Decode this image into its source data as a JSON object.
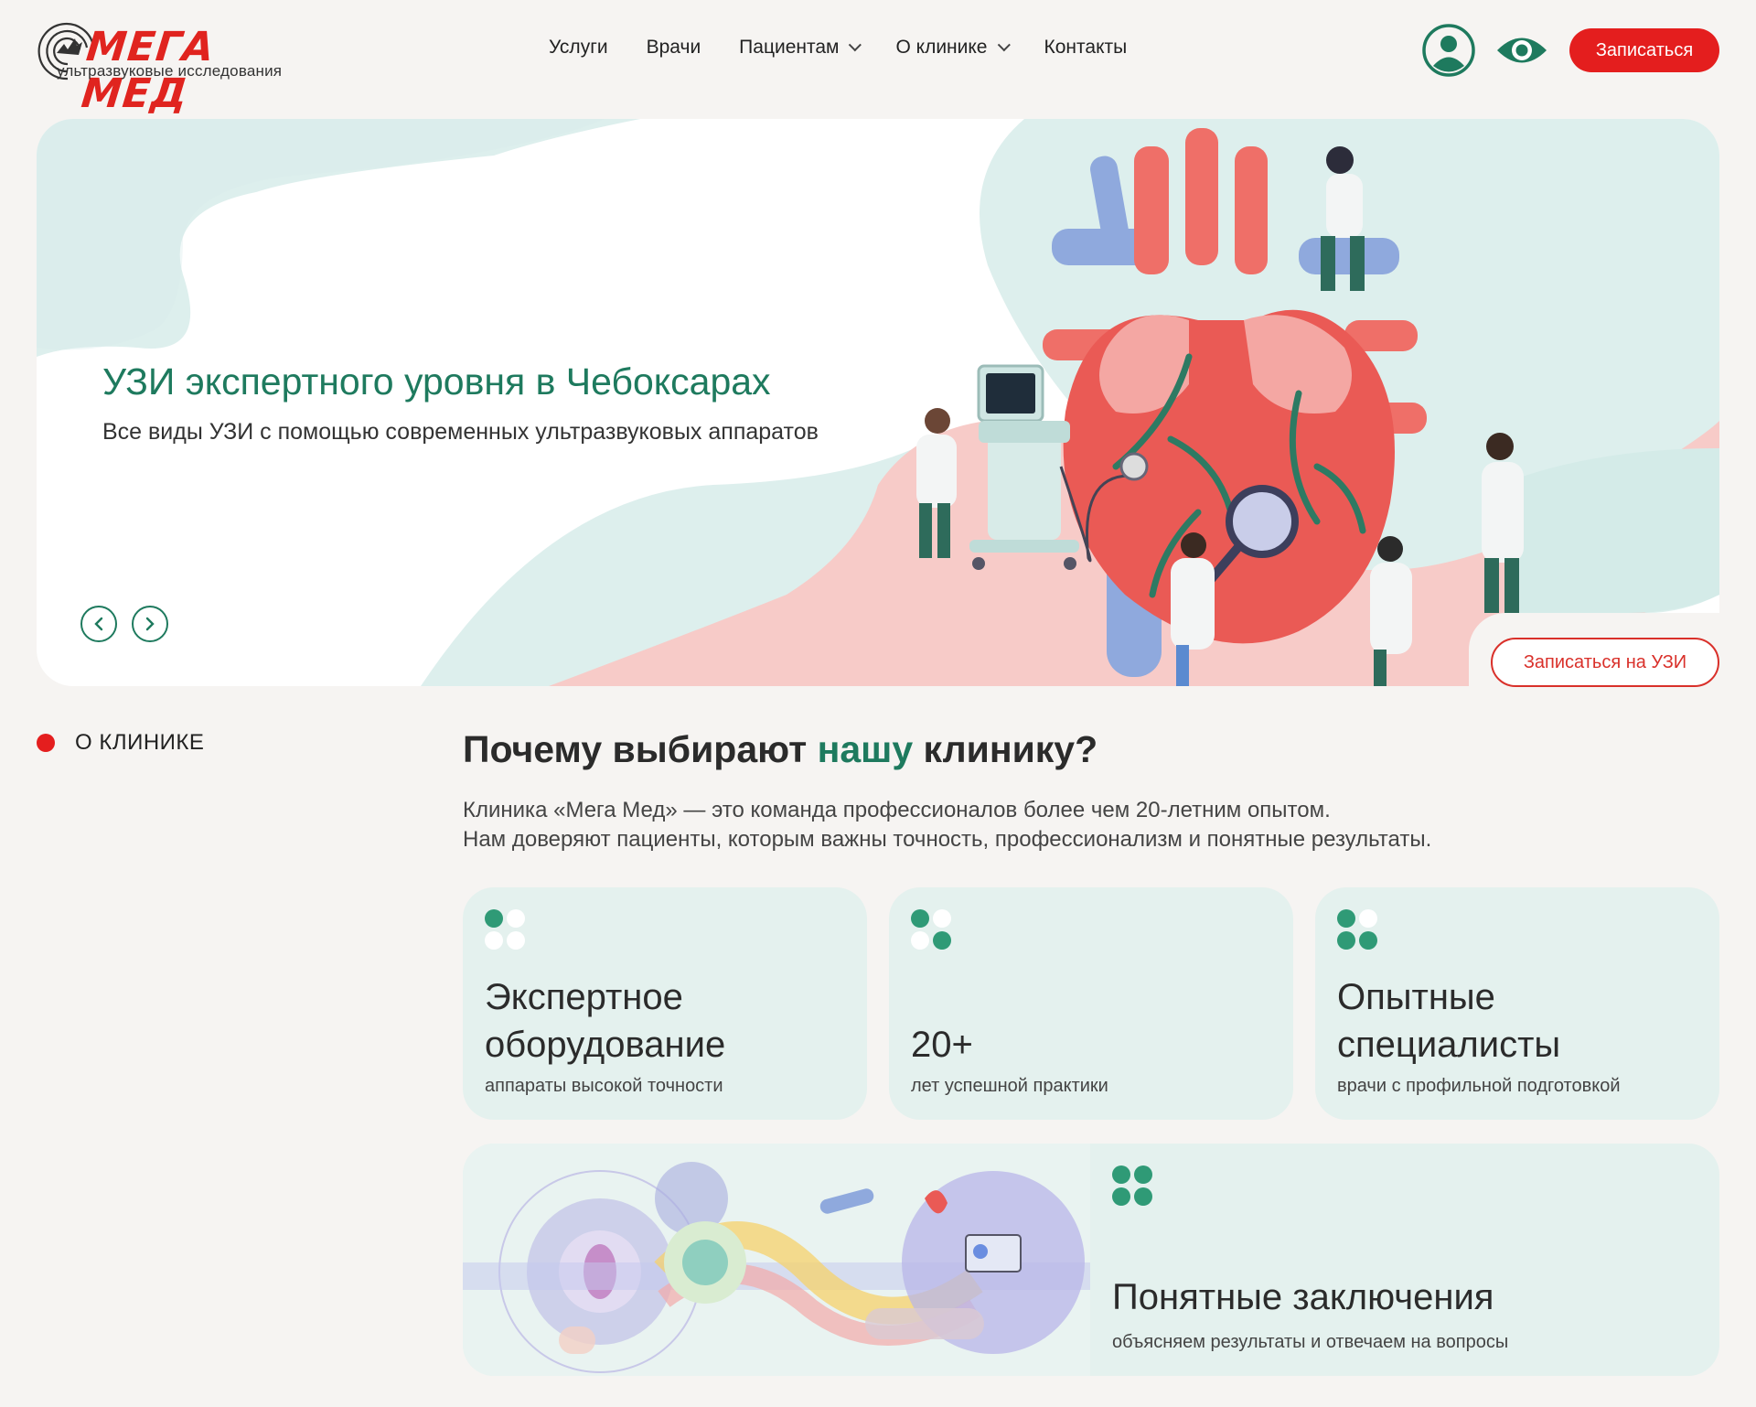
{
  "brand": {
    "name": "МЕГА МЕД",
    "tagline": "ультразвуковые исследования",
    "colors": {
      "red": "#e41e1e",
      "green": "#1e7a5e",
      "mint": "#e4f1ee"
    }
  },
  "nav": {
    "items": [
      {
        "label": "Услуги",
        "dropdown": false
      },
      {
        "label": "Врачи",
        "dropdown": false
      },
      {
        "label": "Пациентам",
        "dropdown": true
      },
      {
        "label": "О клинике",
        "dropdown": true
      },
      {
        "label": "Контакты",
        "dropdown": false
      }
    ],
    "user_icon": "user-account-icon",
    "accessibility_icon": "eye-icon",
    "cta_label": "Записаться"
  },
  "hero": {
    "title": "УЗИ экспертного уровня в Чебоксарах",
    "subtitle": "Все виды УЗИ с помощью современных ультразвуковых аппаратов",
    "prev_icon": "chevron-left-icon",
    "next_icon": "chevron-right-icon",
    "cta_label": "Записаться на УЗИ"
  },
  "about": {
    "label": "О КЛИНИКЕ",
    "title_before": "Почему выбирают ",
    "title_accent": "нашу",
    "title_after": " клинику?",
    "text_line1": "Клиника «Мега Мед» — это команда профессионалов более чем 20-летним опытом.",
    "text_line2": "Нам доверяют пациенты, которым важны точность, профессионализм и понятные результаты.",
    "cards": [
      {
        "title_line1": "Экспертное",
        "title_line2": "оборудование",
        "subtitle": "аппараты высокой точности",
        "filled_dots": 1
      },
      {
        "title_line1": "",
        "title_line2": "20+",
        "subtitle": "лет успешной практики",
        "filled_dots": 2
      },
      {
        "title_line1": "Опытные",
        "title_line2": "специалисты",
        "subtitle": "врачи с профильной подготовкой",
        "filled_dots": 3
      }
    ],
    "wide_card": {
      "title": "Понятные заключения",
      "subtitle": "объясняем результаты и отвечаем на вопросы",
      "filled_dots": 4
    }
  }
}
